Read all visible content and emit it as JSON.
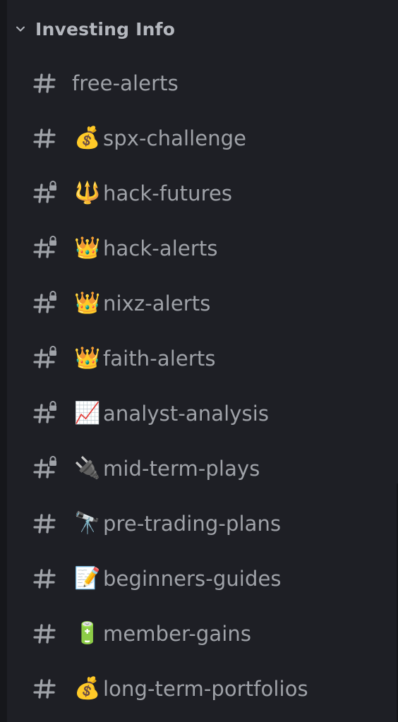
{
  "category": {
    "title": "Investing Info",
    "icon": "chevron-down-icon",
    "text_color": "#b4b7be"
  },
  "channels": [
    {
      "name": "free-alerts",
      "emoji": "",
      "locked": false
    },
    {
      "name": "spx-challenge",
      "emoji": "💰",
      "locked": false
    },
    {
      "name": "hack-futures",
      "emoji": "🔱",
      "locked": true
    },
    {
      "name": "hack-alerts",
      "emoji": "👑",
      "locked": true
    },
    {
      "name": "nixz-alerts",
      "emoji": "👑",
      "locked": true
    },
    {
      "name": "faith-alerts",
      "emoji": "👑",
      "locked": true
    },
    {
      "name": "analyst-analysis",
      "emoji": "📈",
      "locked": true
    },
    {
      "name": "mid-term-plays",
      "emoji": "🔌",
      "locked": true
    },
    {
      "name": "pre-trading-plans",
      "emoji": "🔭",
      "locked": false
    },
    {
      "name": "beginners-guides",
      "emoji": "📝",
      "locked": false
    },
    {
      "name": "member-gains",
      "emoji": "🔋",
      "locked": false
    },
    {
      "name": "long-term-portfolios",
      "emoji": "💰",
      "locked": false
    }
  ],
  "colors": {
    "background": "#1e1f25",
    "channel_text": "#9fa2a8",
    "hash_icon": "#9fa2a8"
  }
}
